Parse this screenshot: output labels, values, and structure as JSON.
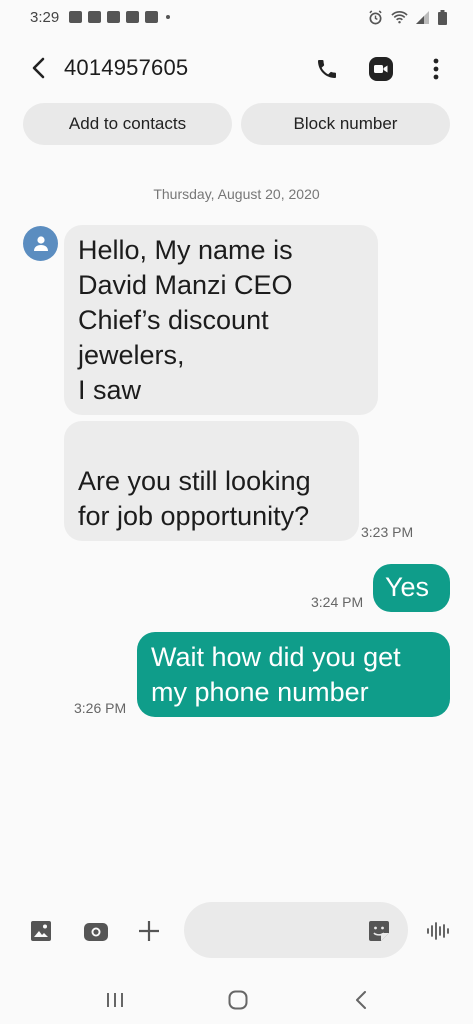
{
  "status_bar": {
    "time": "3:29"
  },
  "header": {
    "contact_number": "4014957605"
  },
  "actions": {
    "add_to_contacts": "Add to contacts",
    "block_number": "Block number"
  },
  "conversation": {
    "date": "Thursday, August 20, 2020",
    "messages": [
      {
        "direction": "incoming",
        "text": "Hello, My name is\nDavid Manzi CEO\nChief’s discount\njewelers,\nI saw"
      },
      {
        "direction": "incoming",
        "text": "\nAre you still looking\nfor job opportunity?",
        "time": "3:23 PM"
      },
      {
        "direction": "outgoing",
        "text": "Yes",
        "time": "3:24 PM"
      },
      {
        "direction": "outgoing",
        "text": "Wait how did you get\nmy phone number",
        "time": "3:26 PM"
      }
    ]
  },
  "composer": {
    "placeholder": ""
  },
  "colors": {
    "outgoing_bubble": "#0f9d8a",
    "incoming_bubble": "#ececec",
    "avatar": "#5b8dc0"
  },
  "icons": [
    "back-icon",
    "phone-icon",
    "video-call-icon",
    "more-options-icon",
    "gallery-icon",
    "camera-icon",
    "plus-icon",
    "sticker-icon",
    "voice-icon",
    "recent-apps-icon",
    "home-icon",
    "nav-back-icon"
  ]
}
